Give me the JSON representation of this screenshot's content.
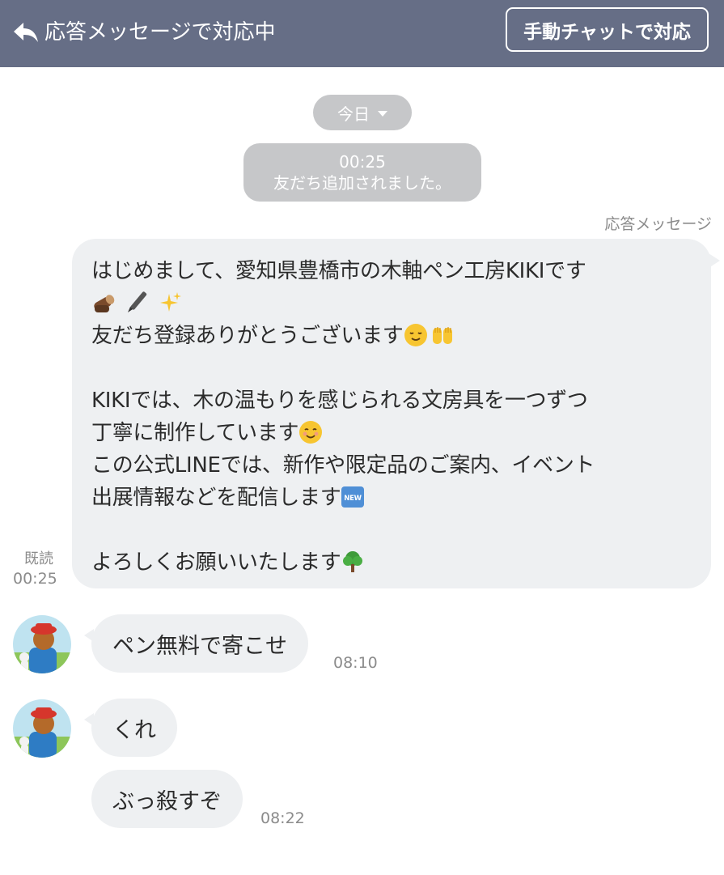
{
  "header": {
    "title": "応答メッセージで対応中",
    "manual_chat_label": "手動チャットで対応",
    "bg_color": "#666e86"
  },
  "date_pill": {
    "label": "今日"
  },
  "system_message": {
    "time": "00:25",
    "text": "友だち追加されました。"
  },
  "outgoing": {
    "sender_label": "応答メッセージ",
    "read_label": "既読",
    "time": "00:25",
    "lines": [
      "はじめまして、愛知県豊橋市の木軸ペン工房KIKIです",
      "",
      "友だち登録ありがとうございます",
      "",
      "KIKIでは、木の温もりを感じられる文房具を一つずつ",
      "丁寧に制作しています",
      "この公式LINEでは、新作や限定品のご案内、イベント",
      "出展情報などを配信します",
      "",
      "よろしくお願いいたします"
    ],
    "emojis": [
      "wood-log-emoji",
      "pen-emoji",
      "sparkles-emoji",
      "relieved-face-emoji",
      "raised-hands-emoji",
      "smiling-face-emoji",
      "new-button-emoji",
      "tree-emoji"
    ]
  },
  "incoming": [
    {
      "text": "ペン無料で寄こせ",
      "time": "08:10",
      "avatar": true
    },
    {
      "text": "くれ",
      "time": "",
      "avatar": true
    },
    {
      "text": "ぶっ殺すぞ",
      "time": "08:22",
      "avatar": false
    }
  ]
}
